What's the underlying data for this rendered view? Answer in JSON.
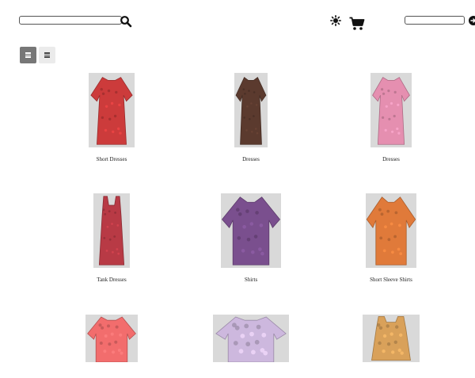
{
  "header": {
    "search": {
      "value": "",
      "placeholder": "",
      "icon": "search-icon"
    },
    "sun_icon": "sun-icon",
    "cart_icon": "cart-icon",
    "selector": {
      "value": ""
    }
  },
  "view_toggle": {
    "grid_icon": "grid-view-icon",
    "list_icon": "list-view-icon",
    "active": "grid"
  },
  "products": [
    {
      "label": "Short Dresses",
      "image": "red-floral-short-dress"
    },
    {
      "label": "Dresses",
      "image": "multicolor-print-dress"
    },
    {
      "label": "Dresses",
      "image": "pink-floral-dress"
    },
    {
      "label": "Tank Dresses",
      "image": "red-white-print-tank-dress"
    },
    {
      "label": "Shirts",
      "image": "purple-print-shirt"
    },
    {
      "label": "Short Sleeve Shirts",
      "image": "orange-short-sleeve-shirt"
    },
    {
      "label": "",
      "image": "coral-top"
    },
    {
      "label": "",
      "image": "lilac-print-top"
    },
    {
      "label": "",
      "image": "tan-print-tank-top"
    }
  ],
  "colors": {
    "red_dress": "#cc3b3b",
    "multicolor_dress": "#5b3a2e",
    "pink_dress": "#e58fb0",
    "red_print": "#b83a45",
    "purple_shirt": "#7a4f8e",
    "orange_shirt": "#e07a3a",
    "coral_top": "#f26d6d",
    "lilac_top": "#cdb8de",
    "tan_top": "#d9a15a"
  }
}
